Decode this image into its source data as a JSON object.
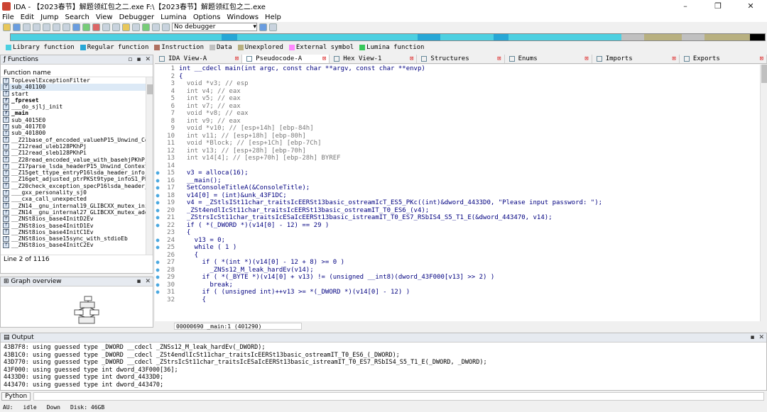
{
  "window": {
    "title": "IDA - 【2023春节】解题领红包之二.exe F:\\【2023春节】解题领红包之二.exe",
    "minimize": "–",
    "maximize": "❐",
    "close": "✕"
  },
  "menu": [
    "File",
    "Edit",
    "Jump",
    "Search",
    "View",
    "Debugger",
    "Lumina",
    "Options",
    "Windows",
    "Help"
  ],
  "toolbar": {
    "debugger_select": "No debugger"
  },
  "legend": [
    {
      "label": "Library function",
      "color": "#4dd0e1"
    },
    {
      "label": "Regular function",
      "color": "#27a7d6"
    },
    {
      "label": "Instruction",
      "color": "#b07060"
    },
    {
      "label": "Data",
      "color": "#c0c0c0"
    },
    {
      "label": "Unexplored",
      "color": "#b8b080"
    },
    {
      "label": "External symbol",
      "color": "#ff88ff"
    },
    {
      "label": "Lumina function",
      "color": "#37c85a"
    }
  ],
  "functions_panel": {
    "title": "Functions",
    "column": "Function name",
    "items": [
      "TopLevelExceptionFilter",
      "sub_401100",
      "start",
      "_fpreset",
      "___do_sjlj_init",
      "_main",
      "sub_4015E0",
      "sub_4017E0",
      "sub_401800",
      "__Z21base_of_encoded_valuehP15_Unwind_Con",
      "__Z12read_uleb128PKhPj",
      "__Z12read_sleb128PKhPi",
      "__Z28read_encoded_value_with_basehjPKhPj",
      "__Z17parse_lsda_headerP15_Unwind_ContextP",
      "__Z15get_ttype_entryP16lsda_header_infoj",
      "__Z16get_adjusted_ptrPKSt9type_infoS1_PPv",
      "__Z20check_exception_specP16lsda_header_i",
      "___gxx_personality_sj0",
      "___cxa_call_unexpected",
      "__ZN14__gnu_internal19_GLIBCXX_mutex_initE",
      "__ZN14__gnu_internal27_GLIBCXX_mutex_addr",
      "__ZNSt8ios_base4InitD2Ev",
      "__ZNSt8ios_base4InitD1Ev",
      "__ZNSt8ios_base4InitC1Ev",
      "__ZNSt8ios_base15sync_with_stdioEb",
      "__ZNSt8ios_base4InitC2Ev"
    ],
    "line_info": "Line 2 of 1116"
  },
  "graph_panel": {
    "title": "Graph overview"
  },
  "tabs": [
    {
      "label": "IDA View-A",
      "active": false
    },
    {
      "label": "Pseudocode-A",
      "active": true
    },
    {
      "label": "Hex View-1",
      "active": false
    },
    {
      "label": "Structures",
      "active": false
    },
    {
      "label": "Enums",
      "active": false
    },
    {
      "label": "Imports",
      "active": false
    },
    {
      "label": "Exports",
      "active": false
    }
  ],
  "code": [
    {
      "n": "1",
      "t": "int __cdecl main(int argc, const char **argv, const char **envp)",
      "dot": false,
      "c": false
    },
    {
      "n": "2",
      "t": "{",
      "dot": false,
      "c": false
    },
    {
      "n": "3",
      "t": "  void *v3; // esp",
      "dot": false,
      "c": true
    },
    {
      "n": "4",
      "t": "  int v4; // eax",
      "dot": false,
      "c": true
    },
    {
      "n": "5",
      "t": "  int v5; // eax",
      "dot": false,
      "c": true
    },
    {
      "n": "6",
      "t": "  int v7; // eax",
      "dot": false,
      "c": true
    },
    {
      "n": "7",
      "t": "  void *v8; // eax",
      "dot": false,
      "c": true
    },
    {
      "n": "8",
      "t": "  int v9; // eax",
      "dot": false,
      "c": true
    },
    {
      "n": "9",
      "t": "  void *v10; // [esp+14h] [ebp-84h]",
      "dot": false,
      "c": true
    },
    {
      "n": "10",
      "t": "  int v11; // [esp+18h] [ebp-80h]",
      "dot": false,
      "c": true
    },
    {
      "n": "11",
      "t": "  void *Block; // [esp+1Ch] [ebp-7Ch]",
      "dot": false,
      "c": true
    },
    {
      "n": "12",
      "t": "  int v13; // [esp+28h] [ebp-70h]",
      "dot": false,
      "c": true
    },
    {
      "n": "13",
      "t": "  int v14[4]; // [esp+70h] [ebp-28h] BYREF",
      "dot": false,
      "c": true
    },
    {
      "n": "14",
      "t": "",
      "dot": false,
      "c": false
    },
    {
      "n": "15",
      "t": "  v3 = alloca(16);",
      "dot": true,
      "c": false
    },
    {
      "n": "16",
      "t": "  __main();",
      "dot": true,
      "c": false
    },
    {
      "n": "17",
      "t": "  SetConsoleTitleA(&ConsoleTitle);",
      "dot": true,
      "c": false
    },
    {
      "n": "18",
      "t": "  v14[0] = (int)&unk_43F1DC;",
      "dot": true,
      "c": false
    },
    {
      "n": "19",
      "t": "  v4 = _ZStlsISt11char_traitsIcEERSt13basic_ostreamIcT_ES5_PKc((int)&dword_4433D0, \"Please input password: \");",
      "dot": true,
      "c": false
    },
    {
      "n": "20",
      "t": "  _ZSt4endlIcSt11char_traitsIcEERSt13basic_ostreamIT_T0_ES6_(v4);",
      "dot": true,
      "c": false
    },
    {
      "n": "21",
      "t": "  _ZStrsIcSt11char_traitsIcESaIcEERSt13basic_istreamIT_T0_ES7_RSbIS4_S5_T1_E(&dword_443470, v14);",
      "dot": true,
      "c": false
    },
    {
      "n": "22",
      "t": "  if ( *(_DWORD *)(v14[0] - 12) == 29 )",
      "dot": true,
      "c": false
    },
    {
      "n": "23",
      "t": "  {",
      "dot": false,
      "c": false
    },
    {
      "n": "24",
      "t": "    v13 = 0;",
      "dot": true,
      "c": false
    },
    {
      "n": "25",
      "t": "    while ( 1 )",
      "dot": true,
      "c": false
    },
    {
      "n": "26",
      "t": "    {",
      "dot": false,
      "c": false
    },
    {
      "n": "27",
      "t": "      if ( *(int *)(v14[0] - 12 + 8) >= 0 )",
      "dot": true,
      "c": false
    },
    {
      "n": "28",
      "t": "        _ZNSs12_M_leak_hardEv(v14);",
      "dot": true,
      "c": false
    },
    {
      "n": "29",
      "t": "      if ( *(_BYTE *)(v14[0] + v13) != (unsigned __int8)(dword_43F000[v13] >> 2) )",
      "dot": true,
      "c": false
    },
    {
      "n": "30",
      "t": "        break;",
      "dot": true,
      "c": false
    },
    {
      "n": "31",
      "t": "      if ( (unsigned int)++v13 >= *(_DWORD *)(v14[0] - 12) )",
      "dot": true,
      "c": false
    },
    {
      "n": "32",
      "t": "      {",
      "dot": false,
      "c": false
    }
  ],
  "code_status": "00000690 _main:1 (401290)",
  "output_panel": {
    "title": "Output",
    "lines": [
      "43B7F8: using guessed type _DWORD __cdecl _ZNSs12_M_leak_hardEv(_DWORD);",
      "43B1C0: using guessed type _DWORD __cdecl _ZSt4endlIcSt11char_traitsIcEERSt13basic_ostreamIT_T0_ES6_(_DWORD);",
      "43D770: using guessed type _DWORD __cdecl _ZStrsIcSt11char_traitsIcESaIcEERSt13basic_istreamIT_T0_ES7_RSbIS4_S5_T1_E(_DWORD, _DWORD);",
      "43F000: using guessed type int dword_43F000[36];",
      "4433D0: using guessed type int dword_4433D0;",
      "443470: using guessed type int dword_443470;"
    ]
  },
  "python_button": "Python",
  "status": {
    "au": "AU:",
    "state": "idle",
    "dir": "Down",
    "disk": "Disk: 46GB"
  }
}
